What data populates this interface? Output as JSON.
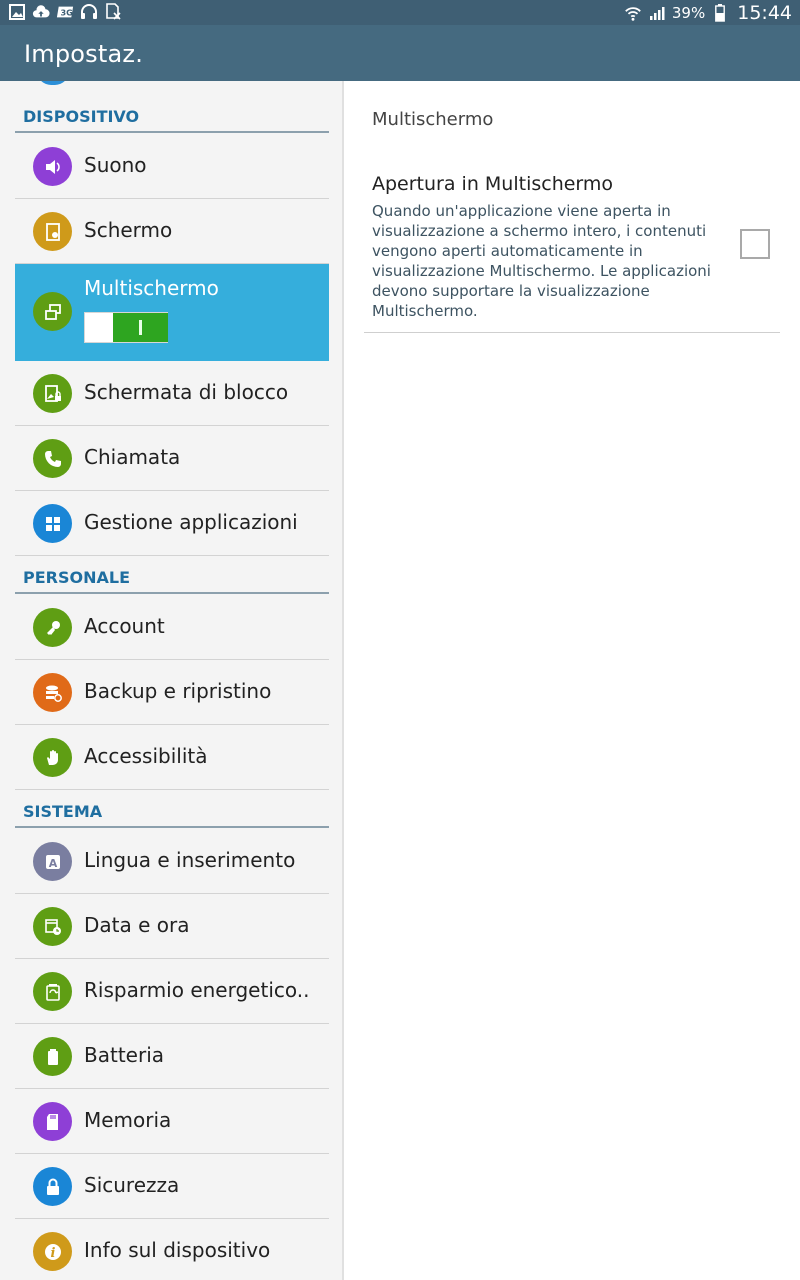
{
  "status_bar": {
    "left_icons": [
      "gallery-icon",
      "cloud-upload-icon",
      "signal-3g-icon",
      "headset-icon",
      "no-sim-icon"
    ],
    "battery_percent": "39%",
    "time": "15:44"
  },
  "action_bar": {
    "title": "Impostaz."
  },
  "sections": [
    {
      "header": "DISPOSITIVO",
      "items": [
        {
          "label": "Suono",
          "icon": "speaker-icon",
          "color": "#8e3fd6"
        },
        {
          "label": "Schermo",
          "icon": "display-icon",
          "color": "#cf9a1a"
        },
        {
          "label": "Multischermo",
          "icon": "multiwindow-icon",
          "color": "#5f9e14",
          "selected": true
        },
        {
          "label": "Schermata di blocco",
          "icon": "lockscreen-icon",
          "color": "#5f9e14"
        },
        {
          "label": "Chiamata",
          "icon": "phone-icon",
          "color": "#5f9e14"
        },
        {
          "label": "Gestione applicazioni",
          "icon": "apps-grid-icon",
          "color": "#1a86d6"
        }
      ]
    },
    {
      "header": "PERSONALE",
      "items": [
        {
          "label": "Account",
          "icon": "key-icon",
          "color": "#5f9e14"
        },
        {
          "label": "Backup e ripristino",
          "icon": "backup-icon",
          "color": "#e06a18"
        },
        {
          "label": "Accessibilità",
          "icon": "hand-icon",
          "color": "#5f9e14"
        }
      ]
    },
    {
      "header": "SISTEMA",
      "items": [
        {
          "label": "Lingua e inserimento",
          "icon": "language-icon",
          "color": "#7a7ea0"
        },
        {
          "label": "Data e ora",
          "icon": "calendar-clock-icon",
          "color": "#5f9e14"
        },
        {
          "label": "Risparmio energetico..",
          "icon": "power-saving-icon",
          "color": "#5f9e14"
        },
        {
          "label": "Batteria",
          "icon": "battery-icon",
          "color": "#5f9e14"
        },
        {
          "label": "Memoria",
          "icon": "sdcard-icon",
          "color": "#8e3fd6"
        },
        {
          "label": "Sicurezza",
          "icon": "lock-icon",
          "color": "#1a86d6"
        },
        {
          "label": "Info sul dispositivo",
          "icon": "info-icon",
          "color": "#cf9a1a"
        }
      ]
    }
  ],
  "multiwindow_toggle_on": true,
  "detail": {
    "title": "Multischermo",
    "pref_title": "Apertura in Multischermo",
    "pref_summary": "Quando un'applicazione viene aperta in visualizzazione a schermo intero, i contenuti vengono aperti automaticamente in visualizzazione Multischermo. Le applicazioni devono supportare la visualizzazione Multischermo.",
    "pref_checked": false
  }
}
